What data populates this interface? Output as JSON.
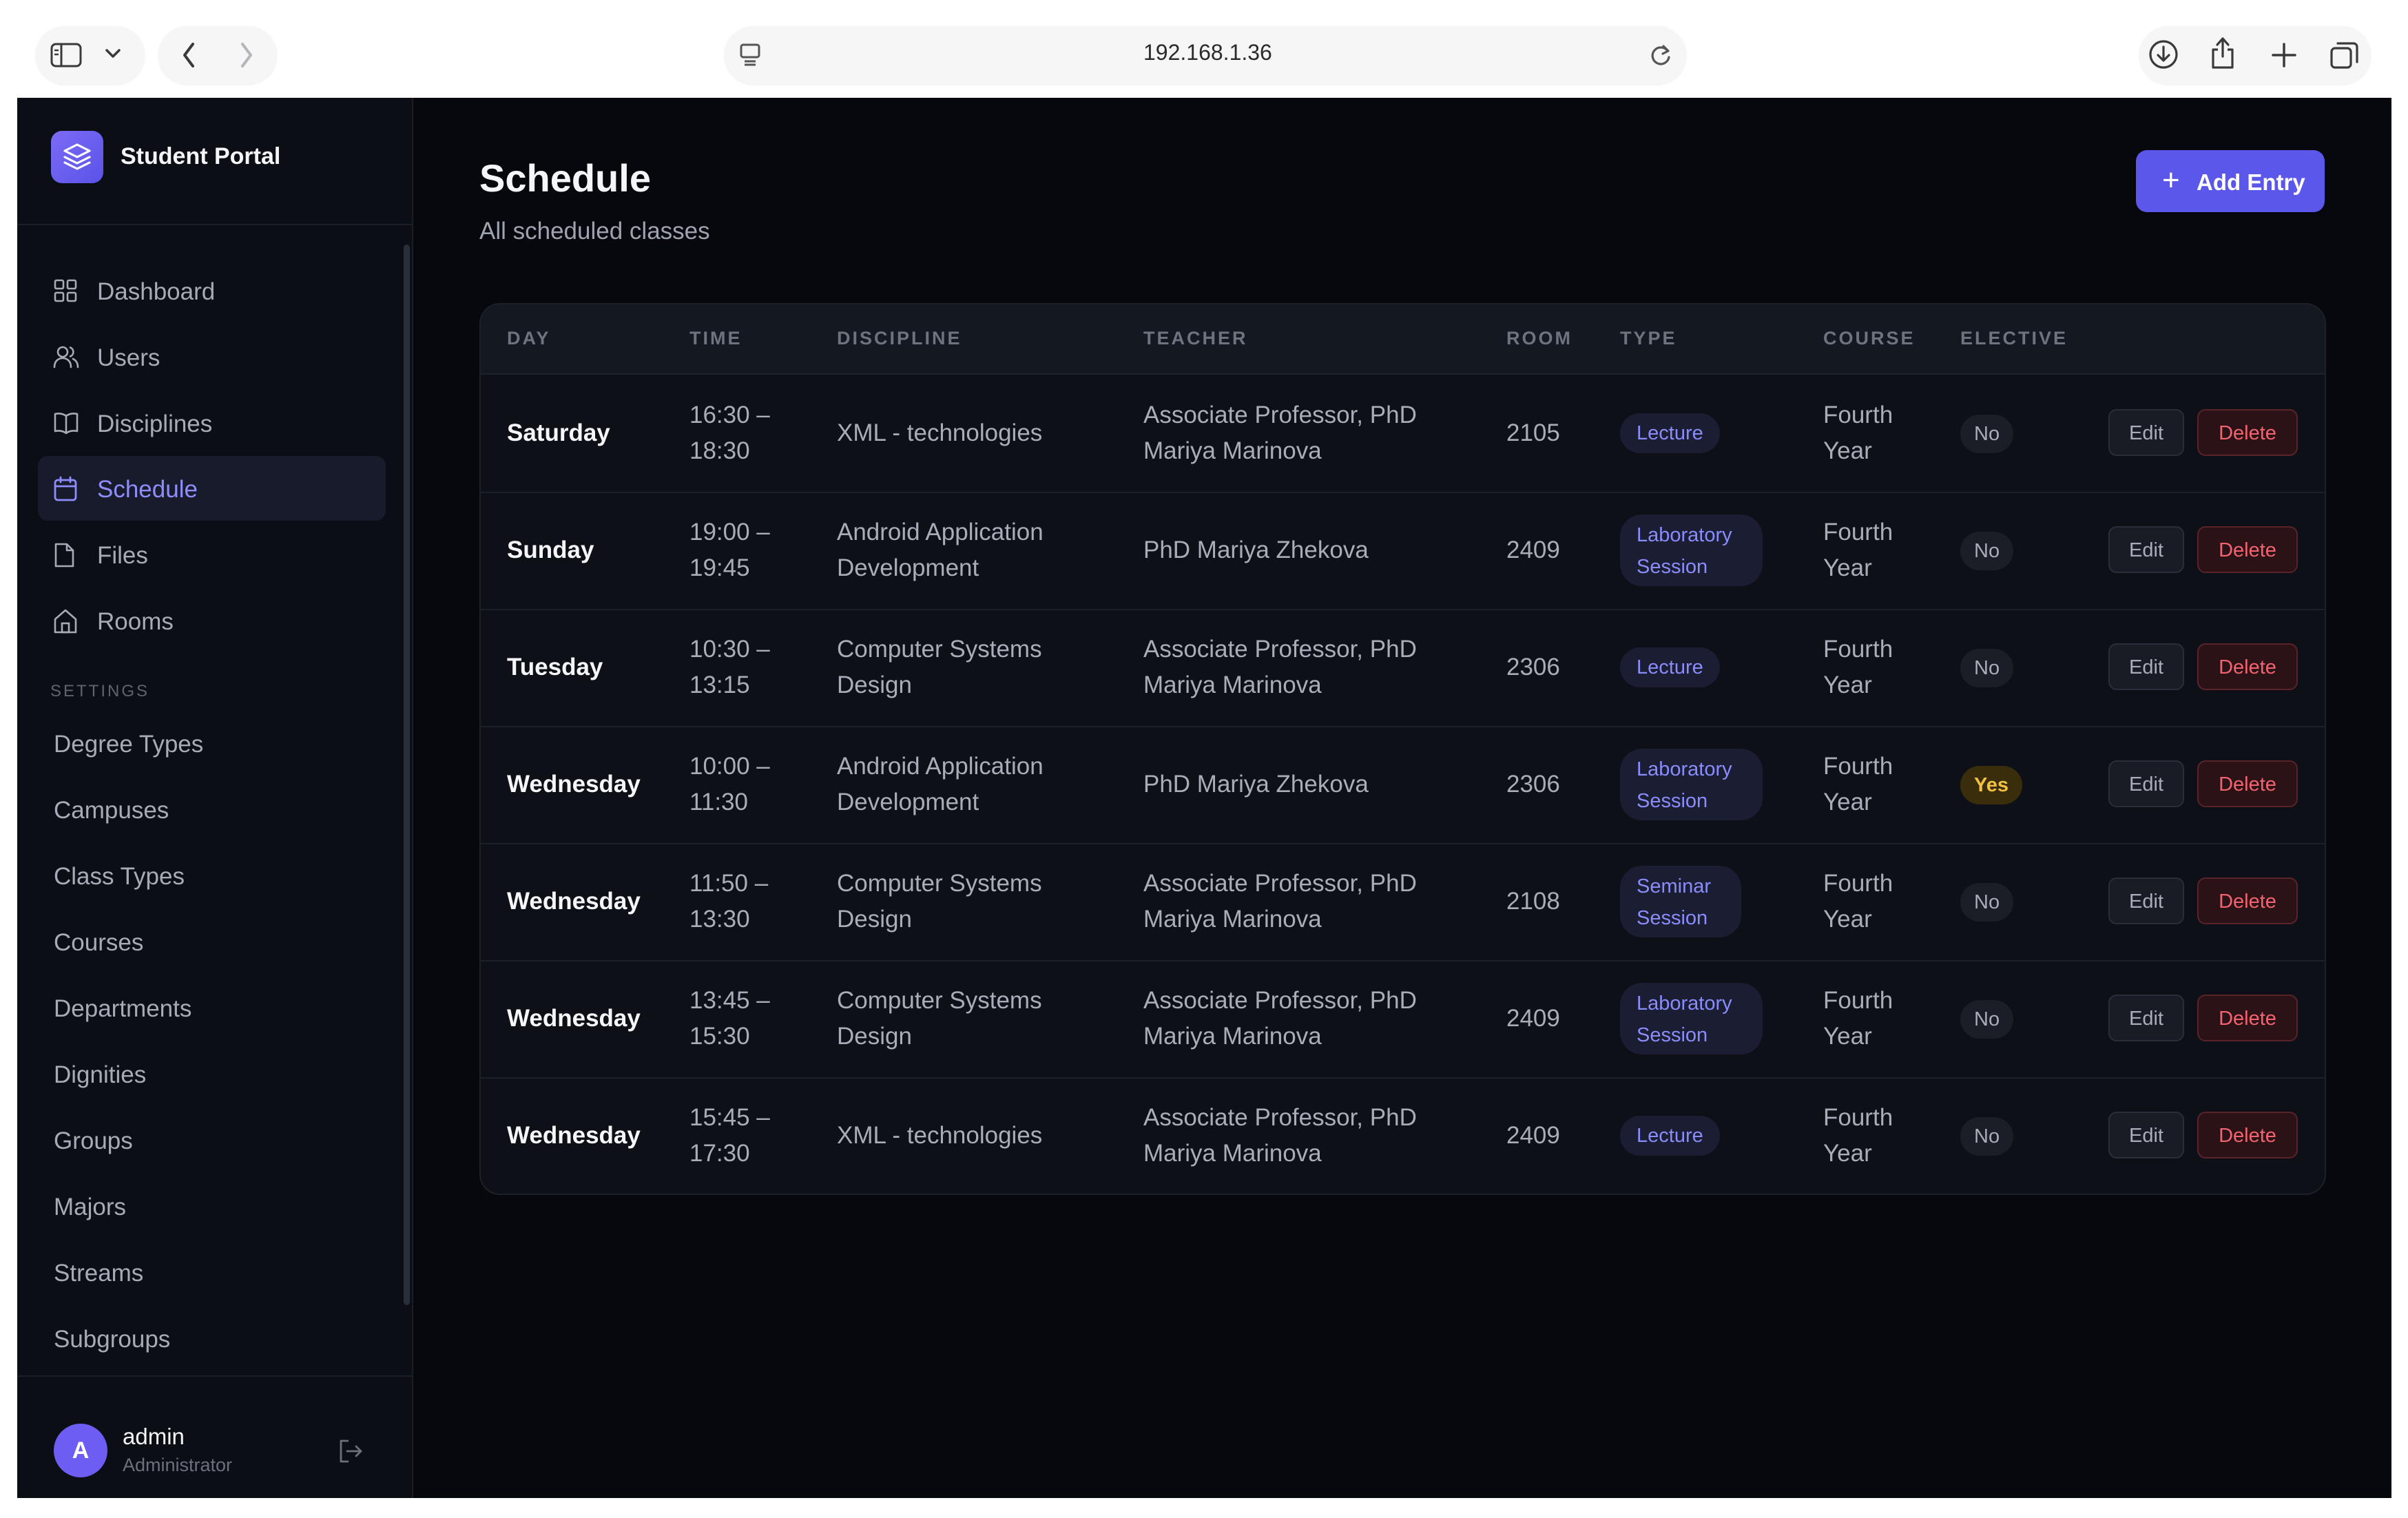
{
  "browser": {
    "url": "192.168.1.36"
  },
  "sidebar": {
    "brand": "Student Portal",
    "nav": [
      {
        "label": "Dashboard",
        "icon": "dashboard-grid-icon"
      },
      {
        "label": "Users",
        "icon": "users-icon"
      },
      {
        "label": "Disciplines",
        "icon": "book-icon"
      },
      {
        "label": "Schedule",
        "icon": "calendar-icon",
        "active": true
      },
      {
        "label": "Files",
        "icon": "file-icon"
      },
      {
        "label": "Rooms",
        "icon": "home-icon"
      }
    ],
    "settings_heading": "SETTINGS",
    "settings": [
      "Degree Types",
      "Campuses",
      "Class Types",
      "Courses",
      "Departments",
      "Dignities",
      "Groups",
      "Majors",
      "Streams",
      "Subgroups"
    ],
    "user": {
      "initial": "A",
      "name": "admin",
      "role": "Administrator"
    }
  },
  "main": {
    "title": "Schedule",
    "subtitle": "All scheduled classes",
    "add_button": "Add Entry"
  },
  "table": {
    "columns": [
      "DAY",
      "TIME",
      "DISCIPLINE",
      "TEACHER",
      "ROOM",
      "TYPE",
      "COURSE",
      "ELECTIVE"
    ],
    "edit_label": "Edit",
    "delete_label": "Delete",
    "rows": [
      {
        "day": "Saturday",
        "time": [
          "16:30 –",
          "18:30"
        ],
        "discipline": [
          "XML - technologies"
        ],
        "teacher": [
          "Associate Professor, PhD",
          "Mariya Marinova"
        ],
        "room": "2105",
        "type": [
          "Lecture"
        ],
        "course": [
          "Fourth",
          "Year"
        ],
        "elective": "No"
      },
      {
        "day": "Sunday",
        "time": [
          "19:00 –",
          "19:45"
        ],
        "discipline": [
          "Android Application",
          "Development"
        ],
        "teacher": [
          "PhD Mariya Zhekova"
        ],
        "room": "2409",
        "type": [
          "Laboratory",
          "Session"
        ],
        "course": [
          "Fourth",
          "Year"
        ],
        "elective": "No"
      },
      {
        "day": "Tuesday",
        "time": [
          "10:30 –",
          "13:15"
        ],
        "discipline": [
          "Computer Systems",
          "Design"
        ],
        "teacher": [
          "Associate Professor, PhD",
          "Mariya Marinova"
        ],
        "room": "2306",
        "type": [
          "Lecture"
        ],
        "course": [
          "Fourth",
          "Year"
        ],
        "elective": "No"
      },
      {
        "day": "Wednesday",
        "time": [
          "10:00 –",
          "11:30"
        ],
        "discipline": [
          "Android Application",
          "Development"
        ],
        "teacher": [
          "PhD Mariya Zhekova"
        ],
        "room": "2306",
        "type": [
          "Laboratory",
          "Session"
        ],
        "course": [
          "Fourth",
          "Year"
        ],
        "elective": "Yes"
      },
      {
        "day": "Wednesday",
        "time": [
          "11:50 –",
          "13:30"
        ],
        "discipline": [
          "Computer Systems",
          "Design"
        ],
        "teacher": [
          "Associate Professor, PhD",
          "Mariya Marinova"
        ],
        "room": "2108",
        "type": [
          "Seminar",
          "Session"
        ],
        "course": [
          "Fourth",
          "Year"
        ],
        "elective": "No"
      },
      {
        "day": "Wednesday",
        "time": [
          "13:45 –",
          "15:30"
        ],
        "discipline": [
          "Computer Systems",
          "Design"
        ],
        "teacher": [
          "Associate Professor, PhD",
          "Mariya Marinova"
        ],
        "room": "2409",
        "type": [
          "Laboratory",
          "Session"
        ],
        "course": [
          "Fourth",
          "Year"
        ],
        "elective": "No"
      },
      {
        "day": "Wednesday",
        "time": [
          "15:45 –",
          "17:30"
        ],
        "discipline": [
          "XML - technologies"
        ],
        "teacher": [
          "Associate Professor, PhD",
          "Mariya Marinova"
        ],
        "room": "2409",
        "type": [
          "Lecture"
        ],
        "course": [
          "Fourth",
          "Year"
        ],
        "elective": "No"
      }
    ]
  },
  "colors": {
    "accent": "#5b57ea",
    "app_background": "#06080d",
    "sidebar_background": "#0b0e15",
    "delete": "#f36470",
    "elective_yes": "#f2c23e"
  }
}
